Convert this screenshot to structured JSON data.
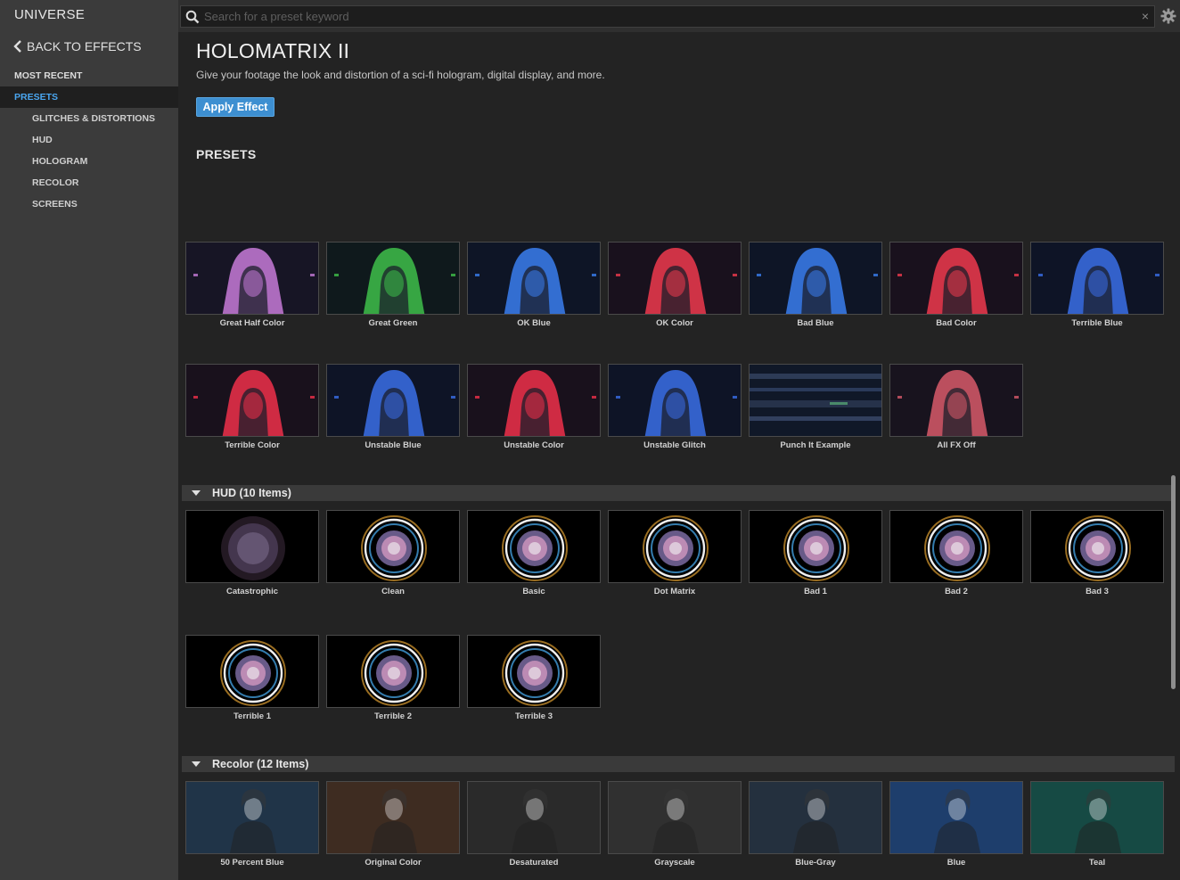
{
  "app": {
    "brand": "UNIVERSE"
  },
  "sidebar": {
    "back_label": "BACK TO EFFECTS",
    "items": [
      {
        "label": "MOST RECENT",
        "active": false,
        "sub": false
      },
      {
        "label": "PRESETS",
        "active": true,
        "sub": false
      },
      {
        "label": "GLITCHES & DISTORTIONS",
        "active": false,
        "sub": true
      },
      {
        "label": "HUD",
        "active": false,
        "sub": true
      },
      {
        "label": "HOLOGRAM",
        "active": false,
        "sub": true
      },
      {
        "label": "RECOLOR",
        "active": false,
        "sub": true
      },
      {
        "label": "SCREENS",
        "active": false,
        "sub": true
      }
    ]
  },
  "search": {
    "placeholder": "Search for a preset keyword",
    "value": "",
    "clear_icon": "×"
  },
  "header": {
    "title": "HOLOMATRIX II",
    "description": "Give your footage the look and distortion of a sci-fi hologram, digital display, and more.",
    "apply_label": "Apply Effect",
    "presets_heading": "PRESETS"
  },
  "hologram": {
    "items": [
      {
        "label": "Great Half Color",
        "color": "#c77ad8"
      },
      {
        "label": "Great Green",
        "color": "#3ec04a"
      },
      {
        "label": "OK Blue",
        "color": "#3a7ef0"
      },
      {
        "label": "OK Color",
        "color": "#f03a4e"
      },
      {
        "label": "Bad Blue",
        "color": "#3a7ef0"
      },
      {
        "label": "Bad Color",
        "color": "#f03a4e"
      },
      {
        "label": "Terrible Blue",
        "color": "#3a6ee8"
      },
      {
        "label": "Terrible Color",
        "color": "#f0304a"
      },
      {
        "label": "Unstable Blue",
        "color": "#3a6ee8"
      },
      {
        "label": "Unstable Color",
        "color": "#f0304a"
      },
      {
        "label": "Unstable Glitch",
        "color": "#3a6ee8"
      },
      {
        "label": "Punch It Example",
        "color": "#3a4a6a"
      },
      {
        "label": "All FX Off",
        "color": "#d85a6a"
      }
    ]
  },
  "hud": {
    "header": "HUD (10 Items)",
    "items": [
      {
        "label": "Catastrophic"
      },
      {
        "label": "Clean"
      },
      {
        "label": "Basic"
      },
      {
        "label": "Dot Matrix"
      },
      {
        "label": "Bad 1"
      },
      {
        "label": "Bad 2"
      },
      {
        "label": "Bad 3"
      },
      {
        "label": "Terrible 1"
      },
      {
        "label": "Terrible 2"
      },
      {
        "label": "Terrible 3"
      }
    ]
  },
  "recolor": {
    "header": "Recolor (12 Items)",
    "items": [
      {
        "label": "50 Percent Blue",
        "color": "#2f4a66"
      },
      {
        "label": "Original Color",
        "color": "#5a4030"
      },
      {
        "label": "Desaturated",
        "color": "#3c3c3c"
      },
      {
        "label": "Grayscale",
        "color": "#444444"
      },
      {
        "label": "Blue-Gray",
        "color": "#34465a"
      },
      {
        "label": "Blue",
        "color": "#2a5a9a"
      },
      {
        "label": "Teal",
        "color": "#1f6a62"
      }
    ]
  }
}
